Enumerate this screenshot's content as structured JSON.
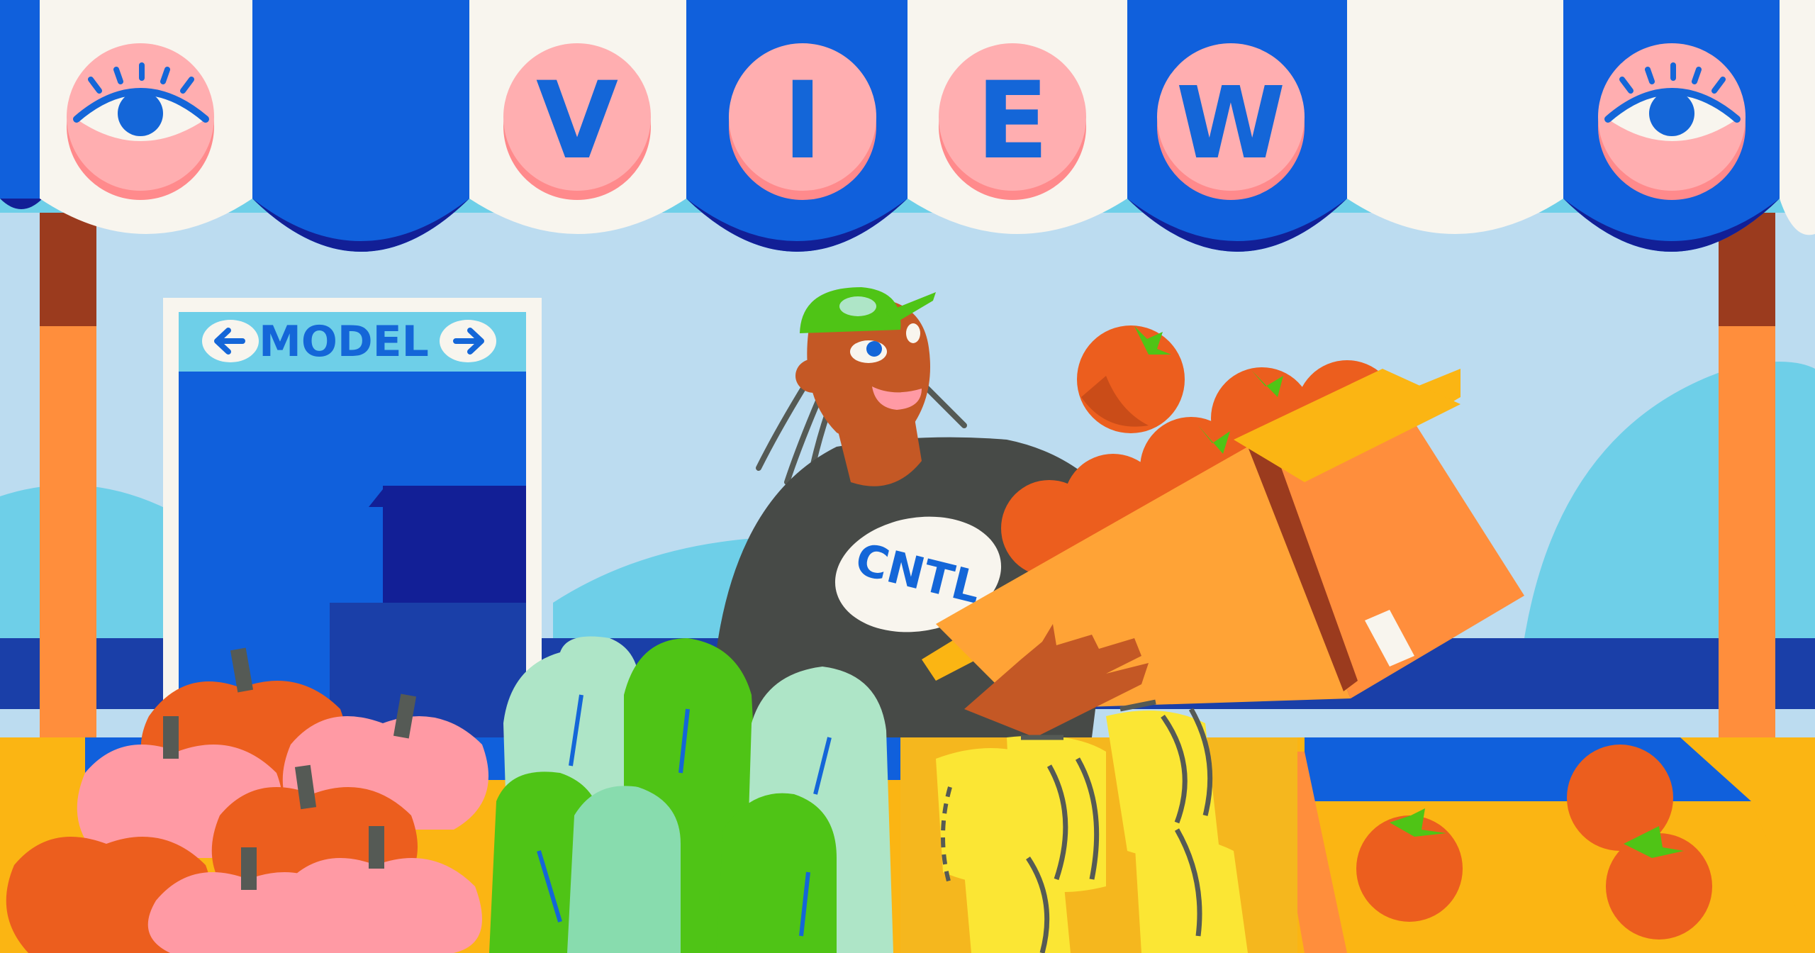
{
  "banner": {
    "badges": [
      {
        "kind": "icon",
        "icon": "eye-icon",
        "text": ""
      },
      {
        "kind": "letter",
        "icon": "",
        "text": "V"
      },
      {
        "kind": "letter",
        "icon": "",
        "text": "I"
      },
      {
        "kind": "letter",
        "icon": "",
        "text": "E"
      },
      {
        "kind": "letter",
        "icon": "",
        "text": "W"
      },
      {
        "kind": "icon",
        "icon": "eye-icon",
        "text": ""
      }
    ]
  },
  "door_sign": {
    "label": "MODEL",
    "left_icon": "arrow-left-icon",
    "right_icon": "arrow-right-icon"
  },
  "vendor": {
    "shirt_text": "CNTL"
  },
  "produce": [
    "apples",
    "lettuce",
    "bananas",
    "tomatoes",
    "oranges"
  ],
  "colors": {
    "awning_blue": "#1060dc",
    "awning_white": "#f8f5ee",
    "badge_pink": "#ffaeb0",
    "badge_text": "#1466d8",
    "sky": "#bcdcf0",
    "box_orange": "#ff8e3c",
    "fruit_orange": "#ec5e1e"
  }
}
